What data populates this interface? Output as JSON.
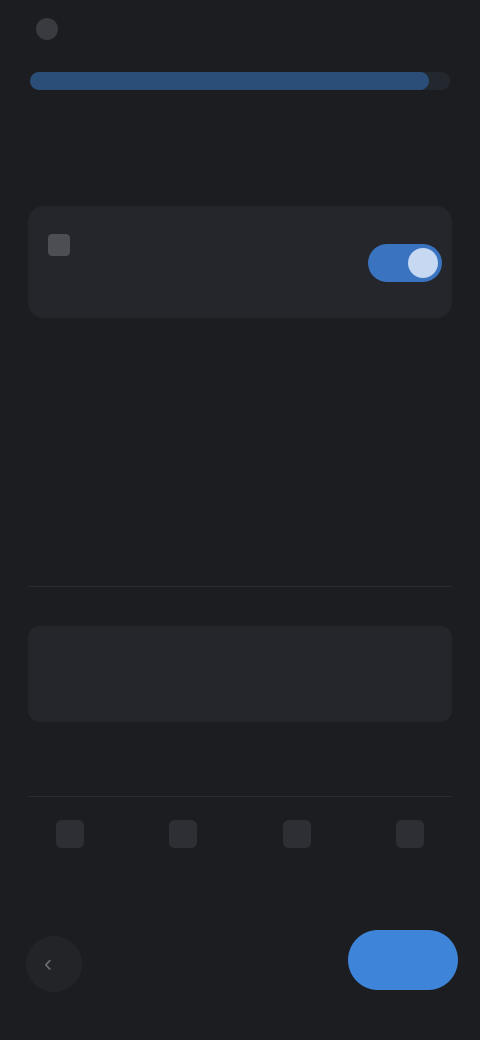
{
  "status_bar": {
    "time": "",
    "right_info": ""
  },
  "progress": {
    "fraction": 0.95
  },
  "page": {
    "title": ""
  },
  "main_card": {
    "title": "",
    "subtitle": "",
    "toggle_on": true
  },
  "section": {
    "label": "",
    "title": "",
    "chips_row1": [
      "",
      "",
      ""
    ],
    "chips_row2": [
      "",
      "",
      ""
    ],
    "chips_row3": [
      "",
      "",
      "",
      ""
    ]
  },
  "note": {
    "label": "",
    "text": ""
  },
  "footer": {
    "left": "",
    "right": ""
  },
  "grid_items": [
    "",
    "",
    "",
    ""
  ],
  "actions": {
    "primary_label": ""
  },
  "colors": {
    "background": "#1c1d21",
    "accent": "#3e84d8",
    "toggle_on": "#3a73c0",
    "progress": "#2b4e78"
  },
  "icons": {
    "status": "app-icon",
    "card": "settings-icon",
    "back": "back-arrow-icon"
  }
}
